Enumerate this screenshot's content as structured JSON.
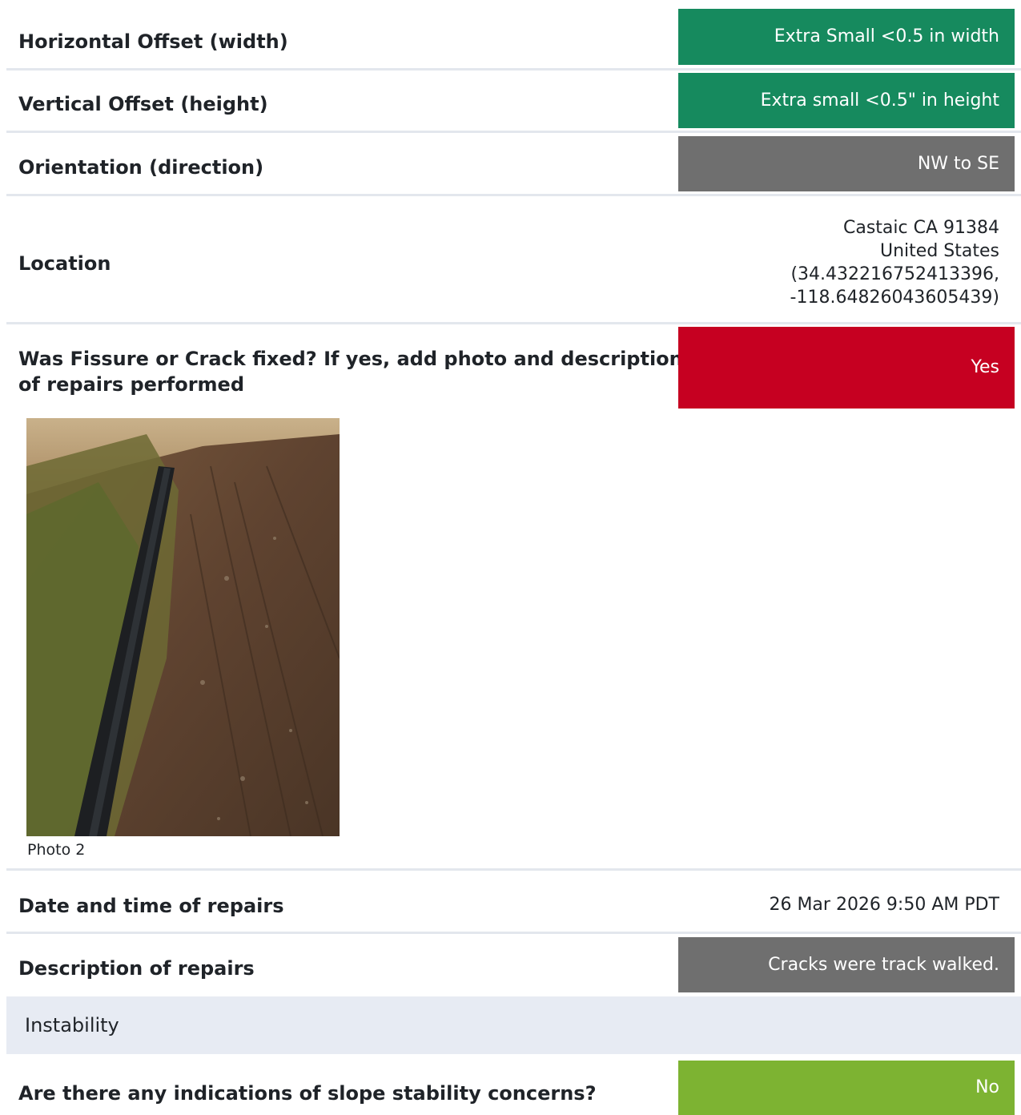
{
  "rows": {
    "horizontal_offset": {
      "label": "Horizontal Offset (width)",
      "value": "Extra Small <0.5 in width",
      "color": "#168a5e"
    },
    "vertical_offset": {
      "label": "Vertical Offset (height)",
      "value": "Extra small <0.5\" in height",
      "color": "#168a5e"
    },
    "orientation": {
      "label": "Orientation (direction)",
      "value": "NW to SE",
      "color": "#6f6f6f"
    },
    "location": {
      "label": "Location",
      "line1": "Castaic CA 91384",
      "line2": "United States",
      "line3": "(34.432216752413396,",
      "line4": "-118.64826043605439)"
    },
    "fixed": {
      "label_line1": "Was Fissure or Crack fixed? If yes, add photo and description",
      "label_line2": "of repairs performed",
      "value": "Yes",
      "color": "#c60021"
    },
    "photo": {
      "caption": "Photo 2",
      "subject": "black pipe along dirt slope with vegetation"
    },
    "date_repairs": {
      "label": "Date and time of repairs",
      "value": "26 Mar 2026 9:50 AM PDT"
    },
    "description_repairs": {
      "label": "Description of repairs",
      "value": "Cracks were track walked.",
      "color": "#6f6f6f"
    }
  },
  "section": {
    "title": "Instability"
  },
  "slope": {
    "label": "Are there any indications of slope stability concerns?",
    "value": "No",
    "color": "#7db332"
  }
}
